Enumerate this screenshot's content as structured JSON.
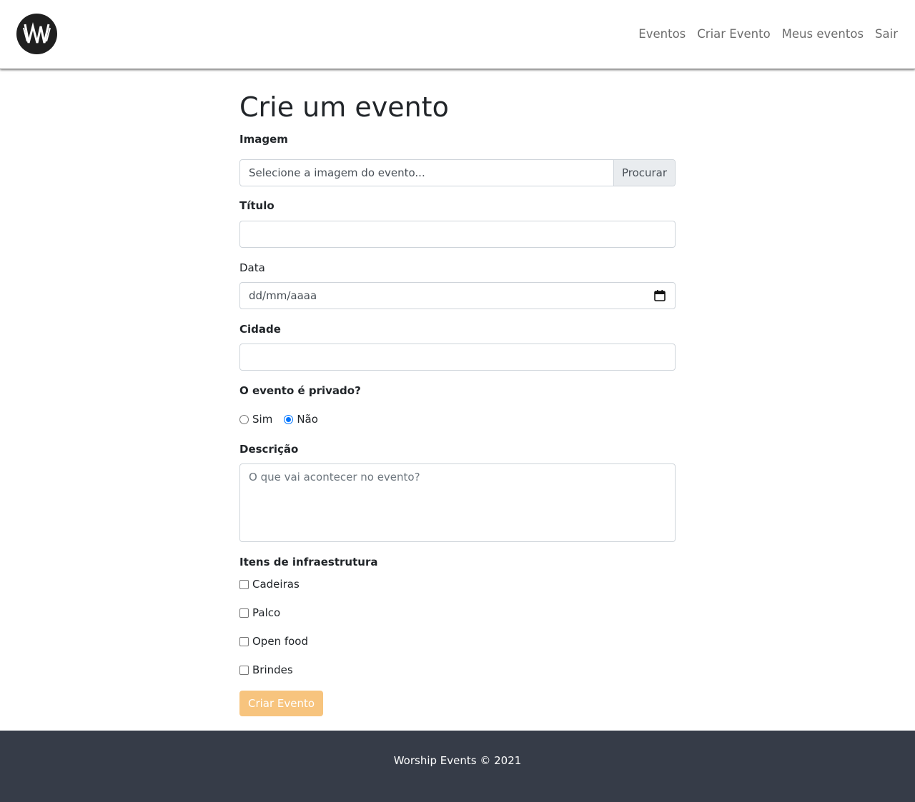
{
  "brand": {
    "logo_icon": "ww-logo-icon"
  },
  "nav": {
    "items": [
      "Eventos",
      "Criar Evento",
      "Meus eventos",
      "Sair"
    ]
  },
  "page": {
    "title": "Crie um evento"
  },
  "form": {
    "image": {
      "label": "Imagem",
      "placeholder": "Selecione a imagem do evento...",
      "browse_label": "Procurar"
    },
    "title": {
      "label": "Título",
      "value": ""
    },
    "date": {
      "label": "Data",
      "placeholder": "dd/mm/aaaa",
      "icon": "calendar-icon"
    },
    "city": {
      "label": "Cidade",
      "value": ""
    },
    "private": {
      "label": "O evento é privado?",
      "options": [
        "Sim",
        "Não"
      ],
      "selected": "Não"
    },
    "description": {
      "label": "Descrição",
      "placeholder": "O que vai acontecer no evento?"
    },
    "infra": {
      "label": "Itens de infraestrutura",
      "items": [
        "Cadeiras",
        "Palco",
        "Open food",
        "Brindes"
      ]
    },
    "submit_label": "Criar Evento"
  },
  "footer": {
    "text": "Worship Events © 2021"
  },
  "colors": {
    "submit_bg": "#f7c47e",
    "footer_bg": "#363c48",
    "radio_accent": "#0075ff"
  }
}
